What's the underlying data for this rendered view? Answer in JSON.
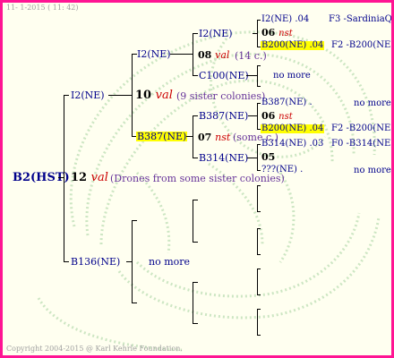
{
  "header": {
    "date_text": "11- 1-2015 ( 11: 42)"
  },
  "root": {
    "label": "B2(HST)"
  },
  "gen1": {
    "val_num": "12",
    "val_tag": "val",
    "note": "(Drones from some sister colonies)",
    "upper": "I2(NE)",
    "lower": "B136(NE)",
    "lower_nomore": "no more"
  },
  "gen2": {
    "val_num": "10",
    "val_tag": "val",
    "note": "(9 sister colonies)",
    "upper": "I2(NE)",
    "lower": "B387(NE)"
  },
  "gen3a": {
    "val_num": "08",
    "val_tag": "val",
    "note": "(14 c.)",
    "upper": "I2(NE)",
    "lower": "C100(NE)",
    "lower_nomore": "no more"
  },
  "gen3b": {
    "val_num": "07",
    "val_tag": "nst",
    "note": "(some c.)",
    "upper": "B387(NE)",
    "lower": "B314(NE)"
  },
  "gen4": [
    {
      "label": "I2(NE)",
      "year": ".04",
      "right": "F3 -SardiniaQ"
    },
    {
      "num": "06",
      "tag": "nst"
    },
    {
      "label": "B200(NE)",
      "year": ".04",
      "right": "F2 -B200(NE)"
    },
    {
      "label": "B387(NE)",
      "year": ".",
      "right": "no more"
    },
    {
      "num": "06",
      "tag": "nst"
    },
    {
      "label": "B200(NE)",
      "year": ".04",
      "right": "F2 -B200(NE)"
    },
    {
      "label": "B314(NE)",
      "year": ".03",
      "right": "F0 -B314(NE)"
    },
    {
      "num": "05",
      "tag": ""
    },
    {
      "label": "???(NE)",
      "year": ".",
      "right": "no more"
    }
  ],
  "footer": {
    "copyright": "Copyright 2004-2015 @ Karl Kehrle Foundation."
  },
  "colors": {
    "border": "#ff1493",
    "background": "#fffff0",
    "highlight": "#ffff00",
    "pedigree_name": "#00008b",
    "note": "#663399",
    "val": "#cc0000"
  }
}
